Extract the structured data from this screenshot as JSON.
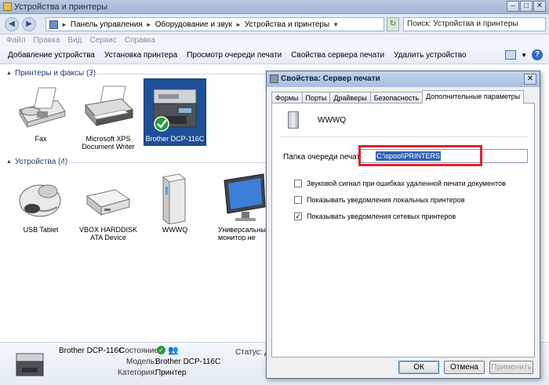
{
  "window": {
    "title": "Устройства и принтеры"
  },
  "caption_buttons": {
    "min": "–",
    "max": "□",
    "close": "✕"
  },
  "address": {
    "crumbs": [
      "Панель управления",
      "Оборудование и звук",
      "Устройства и принтеры"
    ],
    "search_placeholder": "Поиск: Устройства и принтеры"
  },
  "menu": [
    "Файл",
    "Правка",
    "Вид",
    "Сервис",
    "Справка"
  ],
  "toolbar": {
    "add_device": "Добавление устройства",
    "install_printer": "Установка принтера",
    "view_queue": "Просмотр очереди печати",
    "server_props": "Свойства сервера печати",
    "remove_device": "Удалить устройство"
  },
  "groups": {
    "printers": {
      "label": "Принтеры и факсы (3)",
      "items": [
        {
          "label": "Fax",
          "icon": "fax-icon"
        },
        {
          "label": "Microsoft XPS Document Writer",
          "icon": "printer-icon"
        },
        {
          "label": "Brother DCP-116C",
          "icon": "mfp-printer-icon"
        }
      ]
    },
    "devices": {
      "label": "Устройства (4)",
      "items": [
        {
          "label": "USB Tablet",
          "icon": "mouse-icon"
        },
        {
          "label": "VBOX HARDDISK ATA Device",
          "icon": "hard-disk-icon"
        },
        {
          "label": "WWWQ",
          "icon": "computer-tower-icon"
        },
        {
          "label": "Универсальный монитор не PnP",
          "icon": "monitor-icon"
        }
      ]
    }
  },
  "details": {
    "name": "Brother DCP-116C",
    "state_label": "Состояние:",
    "model_label": "Модель:",
    "model_value": "Brother DCP-116C",
    "category_label": "Категория:",
    "category_value": "Принтер",
    "status_label": "Статус: Д"
  },
  "dialog": {
    "title": "Свойства: Сервер печати",
    "tabs": [
      "Формы",
      "Порты",
      "Драйверы",
      "Безопасность",
      "Дополнительные параметры"
    ],
    "active_tab": "Дополнительные параметры",
    "server_name": "WWWQ",
    "spool_label": "Папка очереди печати:",
    "spool_value": "C:\\spool\\PRINTERS",
    "checkboxes": [
      {
        "label": "Звуковой сигнал при ошибках удаленной печати документов",
        "checked": false
      },
      {
        "label": "Показывать уведомления локальных принтеров",
        "checked": false
      },
      {
        "label": "Показывать уведомления сетевых принтеров",
        "checked": true
      }
    ],
    "buttons": {
      "ok": "ОК",
      "cancel": "Отмена",
      "apply": "Применить"
    }
  },
  "colors": {
    "highlight_box": "#e32030",
    "selection": "#3261b6",
    "status_ok": "#2a9d32"
  }
}
